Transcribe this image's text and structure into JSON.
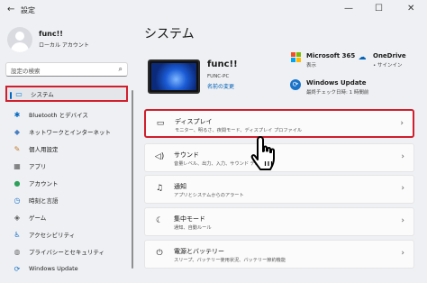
{
  "window": {
    "title": "設定",
    "back_glyph": "←",
    "minimize_glyph": "—",
    "maximize_glyph": "☐",
    "close_glyph": "✕"
  },
  "user": {
    "name": "func!!",
    "account_type": "ローカル アカウント"
  },
  "search": {
    "placeholder": "設定の検索",
    "icon": "search-icon"
  },
  "nav": [
    {
      "label": "システム",
      "icon": "monitor-icon",
      "glyph": "▭",
      "color": "#0078d4"
    },
    {
      "label": "Bluetooth とデバイス",
      "icon": "bluetooth-icon",
      "glyph": "✱",
      "color": "#0067c0"
    },
    {
      "label": "ネットワークとインターネット",
      "icon": "network-icon",
      "glyph": "◆",
      "color": "#4a7fc1"
    },
    {
      "label": "個人用設定",
      "icon": "brush-icon",
      "glyph": "✎",
      "color": "#c27a2c"
    },
    {
      "label": "アプリ",
      "icon": "apps-icon",
      "glyph": "▦",
      "color": "#5b5b5b"
    },
    {
      "label": "アカウント",
      "icon": "account-icon",
      "glyph": "●",
      "color": "#2da15a"
    },
    {
      "label": "時刻と言語",
      "icon": "clock-globe-icon",
      "glyph": "◷",
      "color": "#1a73c9"
    },
    {
      "label": "ゲーム",
      "icon": "gamepad-icon",
      "glyph": "◈",
      "color": "#5b5b5b"
    },
    {
      "label": "アクセシビリティ",
      "icon": "accessibility-icon",
      "glyph": "♿",
      "color": "#1a73c9"
    },
    {
      "label": "プライバシーとセキュリティ",
      "icon": "shield-icon",
      "glyph": "◍",
      "color": "#6b6b6b"
    },
    {
      "label": "Windows Update",
      "icon": "update-icon",
      "glyph": "⟳",
      "color": "#1a73c9"
    }
  ],
  "main": {
    "title": "システム",
    "device": {
      "name": "func!!",
      "model": "FUNC-PC",
      "rename_link": "名前の変更"
    },
    "quick": [
      {
        "title": "Microsoft 365",
        "sub": "表示",
        "icon": "microsoft365-icon"
      },
      {
        "title": "OneDrive",
        "sub": "• サインイン",
        "icon": "onedrive-icon"
      },
      {
        "title": "Windows Update",
        "sub": "最終チェック日時: 1 時間前",
        "icon": "update-icon"
      }
    ],
    "cards": [
      {
        "title": "ディスプレイ",
        "sub": "モニター、明るさ、夜間モード、ディスプレイ プロファイル",
        "icon": "display-icon",
        "glyph": "▭"
      },
      {
        "title": "サウンド",
        "sub": "音量レベル、出力、入力、サウンド デバイス",
        "icon": "speaker-icon",
        "glyph": "◁)"
      },
      {
        "title": "通知",
        "sub": "アプリとシステムからのアラート",
        "icon": "bell-icon",
        "glyph": "♫"
      },
      {
        "title": "集中モード",
        "sub": "通知、自動ルール",
        "icon": "moon-icon",
        "glyph": "☾"
      },
      {
        "title": "電源とバッテリー",
        "sub": "スリープ、バッテリー使用状況、バッテリー節約機能",
        "icon": "power-icon",
        "glyph": "⏻"
      }
    ],
    "chevron": "›"
  },
  "colors": {
    "accent": "#0067c0",
    "highlight_border": "#d01f2d"
  }
}
